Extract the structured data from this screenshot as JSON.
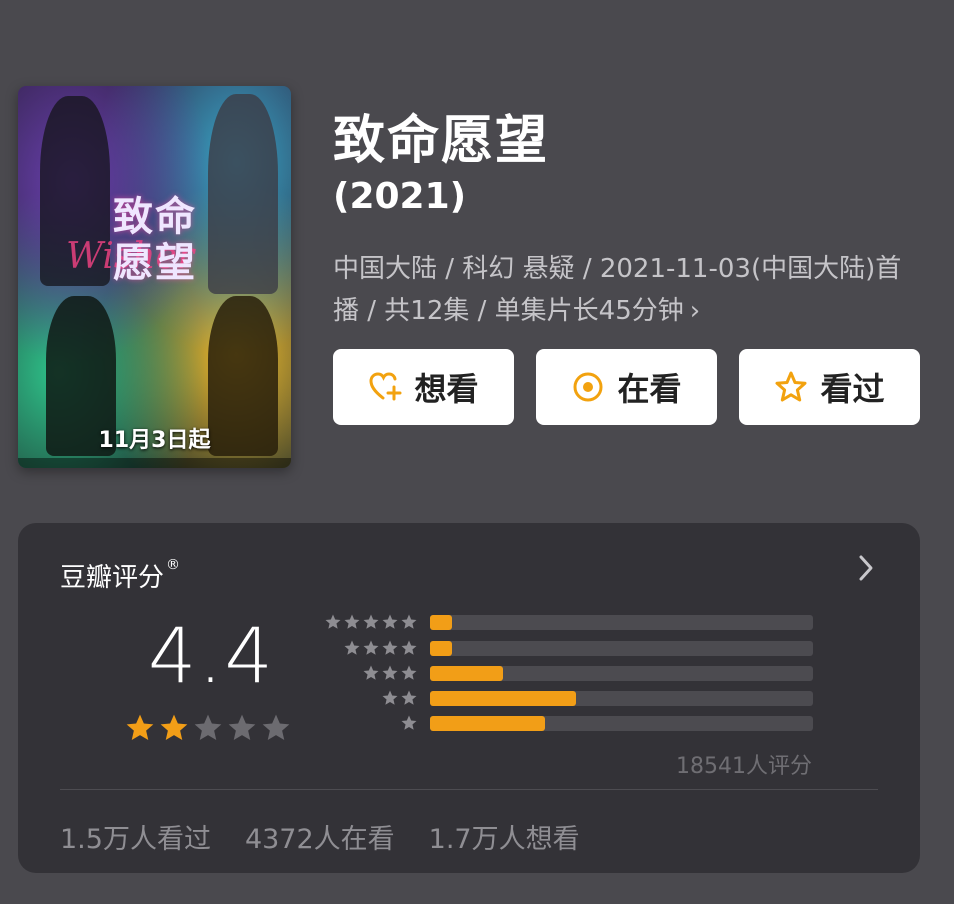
{
  "poster": {
    "title": "致命愿望",
    "subtitle": "Wisher",
    "release_caption": "11月3日起"
  },
  "movie": {
    "title": "致命愿望",
    "year": "(2021)",
    "meta_line": "中国大陆 / 科幻 悬疑 / 2021-11-03(中国大陆)首播 / 共12集 / 单集片长45分钟",
    "meta_chevron": "›"
  },
  "actions": {
    "want": {
      "label": "想看",
      "icon": "heart-plus-icon"
    },
    "watching": {
      "label": "在看",
      "icon": "target-circle-icon"
    },
    "watched": {
      "label": "看过",
      "icon": "star-outline-icon"
    },
    "icon_color": "#f2a20f"
  },
  "rating": {
    "header": "豆瓣评分",
    "header_mark": "®",
    "score": "4.4",
    "stars_filled": 2,
    "stars_total": 5,
    "distribution": [
      {
        "stars": 5,
        "fraction": 0.058
      },
      {
        "stars": 4,
        "fraction": 0.058
      },
      {
        "stars": 3,
        "fraction": 0.19
      },
      {
        "stars": 2,
        "fraction": 0.38
      },
      {
        "stars": 1,
        "fraction": 0.3
      }
    ],
    "count_text": "18541人评分",
    "accent_color": "#f29e17"
  },
  "stats": {
    "watched": "1.5万人看过",
    "watching": "4372人在看",
    "want": "1.7万人想看"
  }
}
